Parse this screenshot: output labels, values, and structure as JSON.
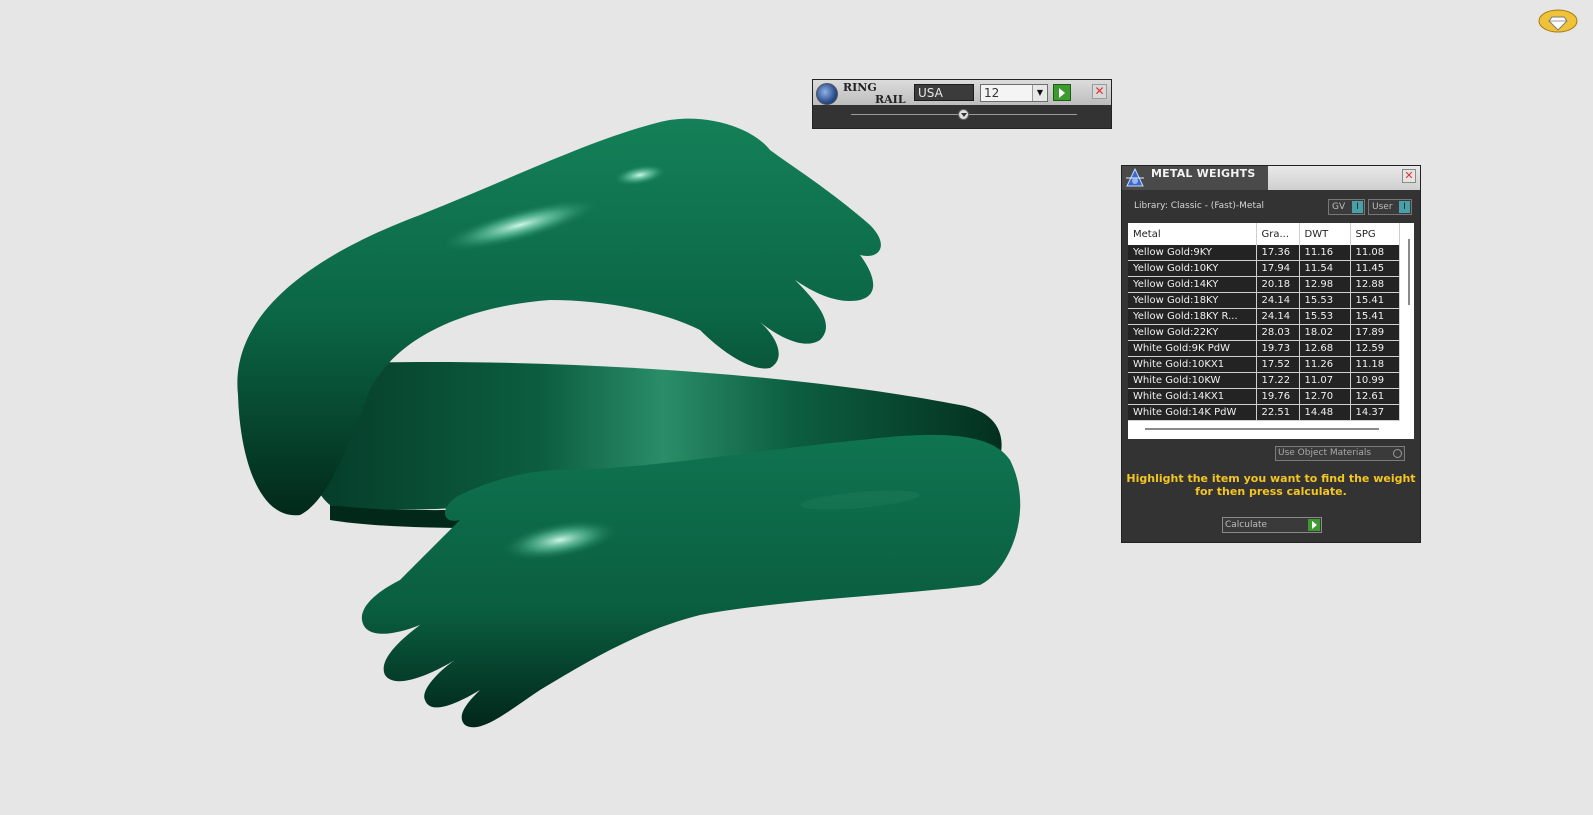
{
  "viewport": {
    "model_name": "",
    "model_color": "#0f6b4a"
  },
  "ring_rail": {
    "title_line1": "RING",
    "title_line2": "RAIL",
    "country": "USA",
    "size": "12",
    "size_dropdown_arrow": "▼",
    "close_glyph": "✕",
    "slider_level": 0.5
  },
  "metal_weights": {
    "title": "METAL WEIGHTS",
    "close_glyph": "✕",
    "library": "Library: Classic - (Fast)-Metal",
    "toggle_gv": {
      "label": "GV",
      "indicator": "I"
    },
    "toggle_user": {
      "label": "User",
      "indicator": "I"
    },
    "columns": [
      "Metal",
      "Gra...",
      "DWT",
      "SPG"
    ],
    "rows": [
      [
        "Yellow Gold:9KY",
        "17.36",
        "11.16",
        "11.08"
      ],
      [
        "Yellow Gold:10KY",
        "17.94",
        "11.54",
        "11.45"
      ],
      [
        "Yellow Gold:14KY",
        "20.18",
        "12.98",
        "12.88"
      ],
      [
        "Yellow Gold:18KY",
        "24.14",
        "15.53",
        "15.41"
      ],
      [
        "Yellow Gold:18KY R...",
        "24.14",
        "15.53",
        "15.41"
      ],
      [
        "Yellow Gold:22KY",
        "28.03",
        "18.02",
        "17.89"
      ],
      [
        "White Gold:9K PdW",
        "19.73",
        "12.68",
        "12.59"
      ],
      [
        "White Gold:10KX1",
        "17.52",
        "11.26",
        "11.18"
      ],
      [
        "White Gold:10KW",
        "17.22",
        "11.07",
        "10.99"
      ],
      [
        "White Gold:14KX1",
        "19.76",
        "12.70",
        "12.61"
      ],
      [
        "White Gold:14K PdW",
        "22.51",
        "14.48",
        "14.37"
      ]
    ],
    "use_object_materials": "Use Object Materials",
    "hint_line1": "Highlight the item you want to find the weight",
    "hint_line2": "for then press calculate.",
    "calculate_label": "Calculate"
  },
  "colors": {
    "accent_green": "#3d9a2e",
    "hint_yellow": "#f5c522",
    "panel_dark": "#333333"
  }
}
